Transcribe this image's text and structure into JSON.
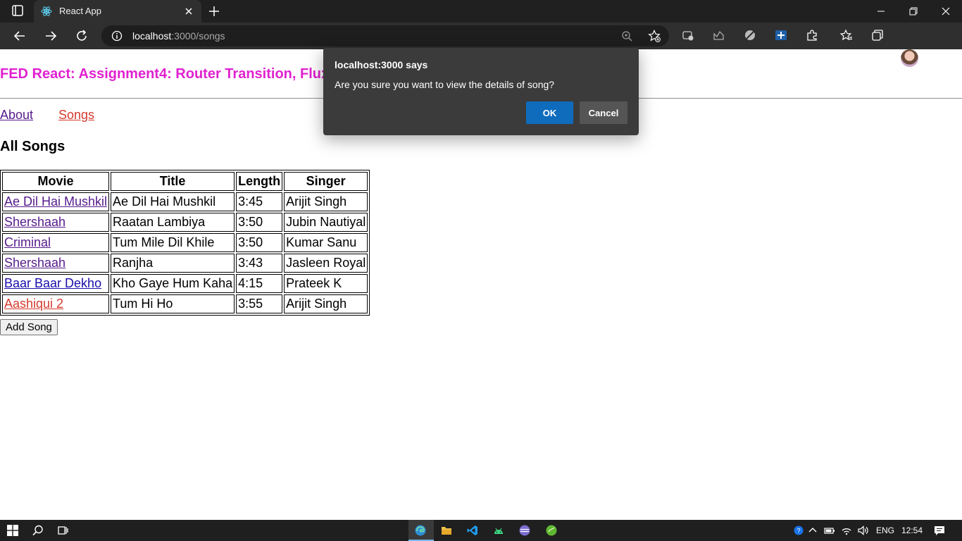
{
  "browser": {
    "tab_title": "React App",
    "url_host": "localhost",
    "url_path": ":3000/songs"
  },
  "page": {
    "title": "FED React: Assignment4: Router Transition, Flux",
    "nav": {
      "about": "About",
      "songs": "Songs"
    },
    "heading": "All Songs",
    "table": {
      "headers": [
        "Movie",
        "Title",
        "Length",
        "Singer"
      ],
      "rows": [
        {
          "movie": "Ae Dil Hai Mushkil",
          "title": "Ae Dil Hai Mushkil",
          "length": "3:45",
          "singer": "Arijit Singh",
          "link_color": "#551a8b"
        },
        {
          "movie": "Shershaah",
          "title": "Raatan Lambiya",
          "length": "3:50",
          "singer": "Jubin Nautiyal",
          "link_color": "#551a8b"
        },
        {
          "movie": "Criminal",
          "title": "Tum Mile Dil Khile",
          "length": "3:50",
          "singer": "Kumar Sanu",
          "link_color": "#551a8b"
        },
        {
          "movie": "Shershaah",
          "title": "Ranjha",
          "length": "3:43",
          "singer": "Jasleen Royal",
          "link_color": "#551a8b"
        },
        {
          "movie": "Baar Baar Dekho",
          "title": "Kho Gaye Hum Kaha",
          "length": "4:15",
          "singer": "Prateek K",
          "link_color": "#1a0dab"
        },
        {
          "movie": "Aashiqui 2",
          "title": "Tum Hi Ho",
          "length": "3:55",
          "singer": "Arijit Singh",
          "link_color": "#d43a2e"
        }
      ]
    },
    "add_button": "Add Song"
  },
  "dialog": {
    "title": "localhost:3000 says",
    "message": "Are you sure you want to view the details of song?",
    "ok": "OK",
    "cancel": "Cancel"
  },
  "taskbar": {
    "lang": "ENG",
    "time": "12:54"
  },
  "colors": {
    "title": "#e021d0",
    "visited_link": "#551a8b",
    "active_link": "#d43a2e",
    "dialog_ok": "#0f6cbd"
  }
}
